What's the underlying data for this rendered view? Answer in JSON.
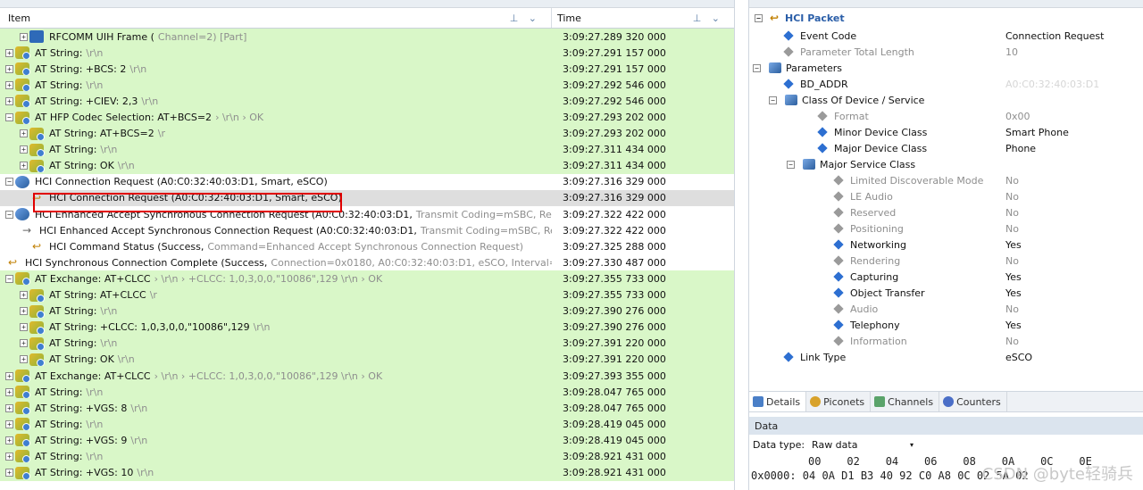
{
  "list": {
    "col_item": "Item",
    "col_time": "Time",
    "rows": [
      {
        "indent": 22,
        "exp": "+",
        "icon": "rf",
        "bg": "green",
        "text": "RFCOMM UIH Frame (",
        "gray": "Channel=2) [Part]",
        "time": "3:09:27.289 320 000"
      },
      {
        "indent": 6,
        "exp": "+",
        "icon": "at",
        "bg": "green",
        "text": "AT String:",
        "gray": "\\r\\n",
        "time": "3:09:27.291 157 000"
      },
      {
        "indent": 6,
        "exp": "+",
        "icon": "at",
        "bg": "green",
        "text": "AT String: +BCS: 2",
        "gray": "\\r\\n",
        "time": "3:09:27.291 157 000"
      },
      {
        "indent": 6,
        "exp": "+",
        "icon": "at",
        "bg": "green",
        "text": "AT String:",
        "gray": "\\r\\n",
        "time": "3:09:27.292 546 000"
      },
      {
        "indent": 6,
        "exp": "+",
        "icon": "at",
        "bg": "green",
        "text": "AT String: +CIEV: 2,3",
        "gray": "\\r\\n",
        "time": "3:09:27.292 546 000"
      },
      {
        "indent": 6,
        "exp": "−",
        "icon": "at",
        "bg": "green",
        "text": "AT HFP Codec Selection: AT+BCS=2",
        "gray": "› \\r\\n › OK",
        "time": "3:09:27.293 202 000"
      },
      {
        "indent": 22,
        "exp": "+",
        "icon": "at",
        "bg": "green",
        "text": "AT String: AT+BCS=2",
        "gray": "\\r",
        "time": "3:09:27.293 202 000"
      },
      {
        "indent": 22,
        "exp": "+",
        "icon": "at",
        "bg": "green",
        "text": "AT String:",
        "gray": "\\r\\n",
        "time": "3:09:27.311 434 000"
      },
      {
        "indent": 22,
        "exp": "+",
        "icon": "at",
        "bg": "green",
        "text": "AT String: OK",
        "gray": "\\r\\n",
        "time": "3:09:27.311 434 000"
      },
      {
        "indent": 6,
        "exp": "−",
        "icon": "hci",
        "bg": "white",
        "text": "HCI Connection Request (A0:C0:32:40:03:D1, Smart, eSCO)",
        "gray": "",
        "time": "3:09:27.316 329 000"
      },
      {
        "indent": 22,
        "exp": "",
        "icon": "arrow",
        "bg": "sel",
        "text": "HCI Connection Request (A0:C0:32:40:03:D1, Smart, eSCO)",
        "gray": "",
        "time": "3:09:27.316 329 000"
      },
      {
        "indent": 6,
        "exp": "−",
        "icon": "hci",
        "bg": "white",
        "text": "HCI Enhanced Accept Synchronous Connection Request (A0:C0:32:40:03:D1,",
        "gray": "Transmit Coding=mSBC, Receive Codin...",
        "time": "3:09:27.322 422 000"
      },
      {
        "indent": 22,
        "exp": "",
        "icon": "garrow",
        "bg": "white",
        "text": "HCI Enhanced Accept Synchronous Connection Request (A0:C0:32:40:03:D1,",
        "gray": "Transmit Coding=mSBC, Receive C...",
        "time": "3:09:27.322 422 000"
      },
      {
        "indent": 22,
        "exp": "",
        "icon": "arrow",
        "bg": "white",
        "text": "HCI Command Status (Success, ",
        "gray": "Command=Enhanced Accept Synchronous Connection Request)",
        "time": "3:09:27.325 288 000"
      },
      {
        "indent": 6,
        "exp": "",
        "icon": "arrow",
        "bg": "white",
        "text": "HCI Synchronous Connection Complete (Success,",
        "gray": "Connection=0x0180, A0:C0:32:40:03:D1, eSCO, Interval=7.5 ms, R...",
        "time": "3:09:27.330 487 000"
      },
      {
        "indent": 6,
        "exp": "−",
        "icon": "at",
        "bg": "green",
        "text": "AT Exchange: AT+CLCC",
        "gray": "› \\r\\n › +CLCC: 1,0,3,0,0,\"10086\",129 \\r\\n › OK",
        "time": "3:09:27.355 733 000"
      },
      {
        "indent": 22,
        "exp": "+",
        "icon": "at",
        "bg": "green",
        "text": "AT String: AT+CLCC",
        "gray": "\\r",
        "time": "3:09:27.355 733 000"
      },
      {
        "indent": 22,
        "exp": "+",
        "icon": "at",
        "bg": "green",
        "text": "AT String:",
        "gray": "\\r\\n",
        "time": "3:09:27.390 276 000"
      },
      {
        "indent": 22,
        "exp": "+",
        "icon": "at",
        "bg": "green",
        "text": "AT String: +CLCC: 1,0,3,0,0,\"10086\",129",
        "gray": "\\r\\n",
        "time": "3:09:27.390 276 000"
      },
      {
        "indent": 22,
        "exp": "+",
        "icon": "at",
        "bg": "green",
        "text": "AT String:",
        "gray": "\\r\\n",
        "time": "3:09:27.391 220 000"
      },
      {
        "indent": 22,
        "exp": "+",
        "icon": "at",
        "bg": "green",
        "text": "AT String: OK",
        "gray": "\\r\\n",
        "time": "3:09:27.391 220 000"
      },
      {
        "indent": 6,
        "exp": "+",
        "icon": "at",
        "bg": "green",
        "text": "AT Exchange: AT+CLCC",
        "gray": "› \\r\\n › +CLCC: 1,0,3,0,0,\"10086\",129 \\r\\n › OK",
        "time": "3:09:27.393 355 000"
      },
      {
        "indent": 6,
        "exp": "+",
        "icon": "at",
        "bg": "green",
        "text": "AT String:",
        "gray": "\\r\\n",
        "time": "3:09:28.047 765 000"
      },
      {
        "indent": 6,
        "exp": "+",
        "icon": "at",
        "bg": "green",
        "text": "AT String: +VGS: 8",
        "gray": "\\r\\n",
        "time": "3:09:28.047 765 000"
      },
      {
        "indent": 6,
        "exp": "+",
        "icon": "at",
        "bg": "green",
        "text": "AT String:",
        "gray": "\\r\\n",
        "time": "3:09:28.419 045 000"
      },
      {
        "indent": 6,
        "exp": "+",
        "icon": "at",
        "bg": "green",
        "text": "AT String: +VGS: 9",
        "gray": "\\r\\n",
        "time": "3:09:28.419 045 000"
      },
      {
        "indent": 6,
        "exp": "+",
        "icon": "at",
        "bg": "green",
        "text": "AT String:",
        "gray": "\\r\\n",
        "time": "3:09:28.921 431 000"
      },
      {
        "indent": 6,
        "exp": "+",
        "icon": "at",
        "bg": "green",
        "text": "AT String: +VGS: 10",
        "gray": "\\r\\n",
        "time": "3:09:28.921 431 000"
      }
    ]
  },
  "details": {
    "title": "HCI Packet",
    "props": [
      {
        "indent": 40,
        "exp": "",
        "kind": "dot",
        "name": "Event Code",
        "value": "Connection Request",
        "dim": false
      },
      {
        "indent": 40,
        "exp": "",
        "kind": "dotg",
        "name": "Parameter Total Length",
        "value": "10",
        "dim": true
      },
      {
        "indent": 22,
        "exp": "−",
        "kind": "group",
        "name": "Parameters",
        "value": "",
        "dim": false
      },
      {
        "indent": 40,
        "exp": "",
        "kind": "dot",
        "name": "BD_ADDR",
        "value": "A0:C0:32:40:03:D1",
        "dim": false,
        "blur": true
      },
      {
        "indent": 40,
        "exp": "−",
        "kind": "group",
        "name": "Class Of Device / Service",
        "value": "",
        "dim": false
      },
      {
        "indent": 78,
        "exp": "",
        "kind": "dotg",
        "name": "Format",
        "value": "0x00",
        "dim": true
      },
      {
        "indent": 78,
        "exp": "",
        "kind": "dot",
        "name": "Minor Device Class",
        "value": "Smart Phone",
        "dim": false
      },
      {
        "indent": 78,
        "exp": "",
        "kind": "dot",
        "name": "Major Device Class",
        "value": "Phone",
        "dim": false
      },
      {
        "indent": 60,
        "exp": "−",
        "kind": "group",
        "name": "Major Service Class",
        "value": "",
        "dim": false
      },
      {
        "indent": 96,
        "exp": "",
        "kind": "dotg",
        "name": "Limited Discoverable Mode",
        "value": "No",
        "dim": true
      },
      {
        "indent": 96,
        "exp": "",
        "kind": "dotg",
        "name": "LE Audio",
        "value": "No",
        "dim": true
      },
      {
        "indent": 96,
        "exp": "",
        "kind": "dotg",
        "name": "Reserved",
        "value": "No",
        "dim": true
      },
      {
        "indent": 96,
        "exp": "",
        "kind": "dotg",
        "name": "Positioning",
        "value": "No",
        "dim": true
      },
      {
        "indent": 96,
        "exp": "",
        "kind": "dot",
        "name": "Networking",
        "value": "Yes",
        "dim": false
      },
      {
        "indent": 96,
        "exp": "",
        "kind": "dotg",
        "name": "Rendering",
        "value": "No",
        "dim": true
      },
      {
        "indent": 96,
        "exp": "",
        "kind": "dot",
        "name": "Capturing",
        "value": "Yes",
        "dim": false
      },
      {
        "indent": 96,
        "exp": "",
        "kind": "dot",
        "name": "Object Transfer",
        "value": "Yes",
        "dim": false
      },
      {
        "indent": 96,
        "exp": "",
        "kind": "dotg",
        "name": "Audio",
        "value": "No",
        "dim": true
      },
      {
        "indent": 96,
        "exp": "",
        "kind": "dot",
        "name": "Telephony",
        "value": "Yes",
        "dim": false
      },
      {
        "indent": 96,
        "exp": "",
        "kind": "dotg",
        "name": "Information",
        "value": "No",
        "dim": true
      },
      {
        "indent": 40,
        "exp": "",
        "kind": "dot",
        "name": "Link Type",
        "value": "eSCO",
        "dim": false
      }
    ]
  },
  "tabs": [
    "Details",
    "Piconets",
    "Channels",
    "Counters"
  ],
  "data_panel": {
    "header": "Data",
    "type_label": "Data type:",
    "type_value": "Raw data",
    "hex_header": "00    02    04    06    08    0A    0C    0E",
    "hex_line": "0x0000: 04 0A D1 B3 40 92 C0 A8 0C 02 5A 02"
  },
  "watermark": "CSDN @byte轻骑兵"
}
